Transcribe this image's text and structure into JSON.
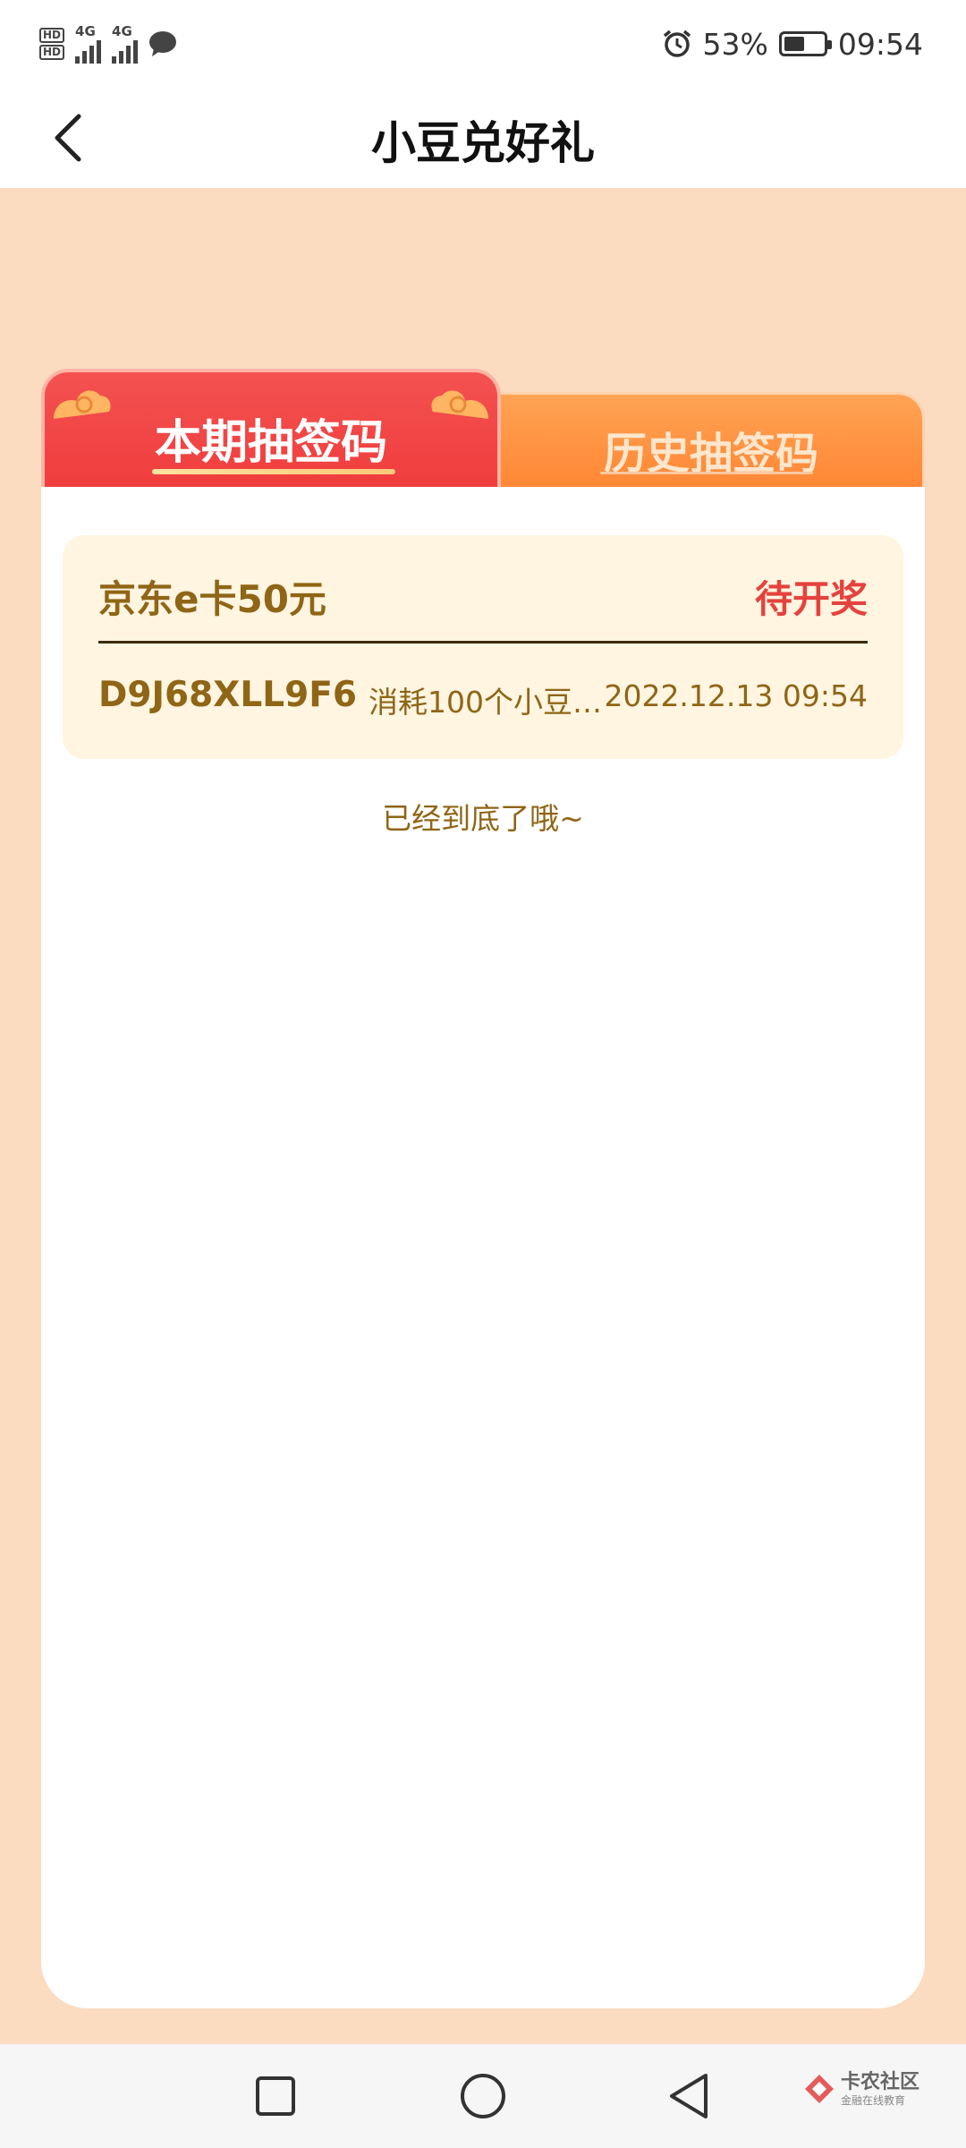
{
  "status_bar": {
    "signal_label_1": "4G",
    "signal_label_2": "4G",
    "hd_label": "HD",
    "battery_percent": "53%",
    "battery_level": 0.53,
    "time": "09:54"
  },
  "header": {
    "title": "小豆兑好礼"
  },
  "tabs": [
    {
      "label": "本期抽签码",
      "active": true
    },
    {
      "label": "历史抽签码",
      "active": false
    }
  ],
  "records": [
    {
      "prize": "京东e卡50元",
      "status": "待开奖",
      "code": "D9J68XLL9F6",
      "cost": "消耗100个小豆…",
      "time": "2022.12.13 09:54"
    }
  ],
  "end_tip": "已经到底了哦~",
  "watermark": {
    "title": "卡农社区",
    "subtitle": "金融在线教育"
  },
  "colors": {
    "page_bg": "#fbdcc0",
    "tab_active": "#f24747",
    "tab_inactive": "#ff9444",
    "record_bg": "#fff5e0",
    "text_brown": "#8f6516",
    "status_red": "#e5423f"
  }
}
